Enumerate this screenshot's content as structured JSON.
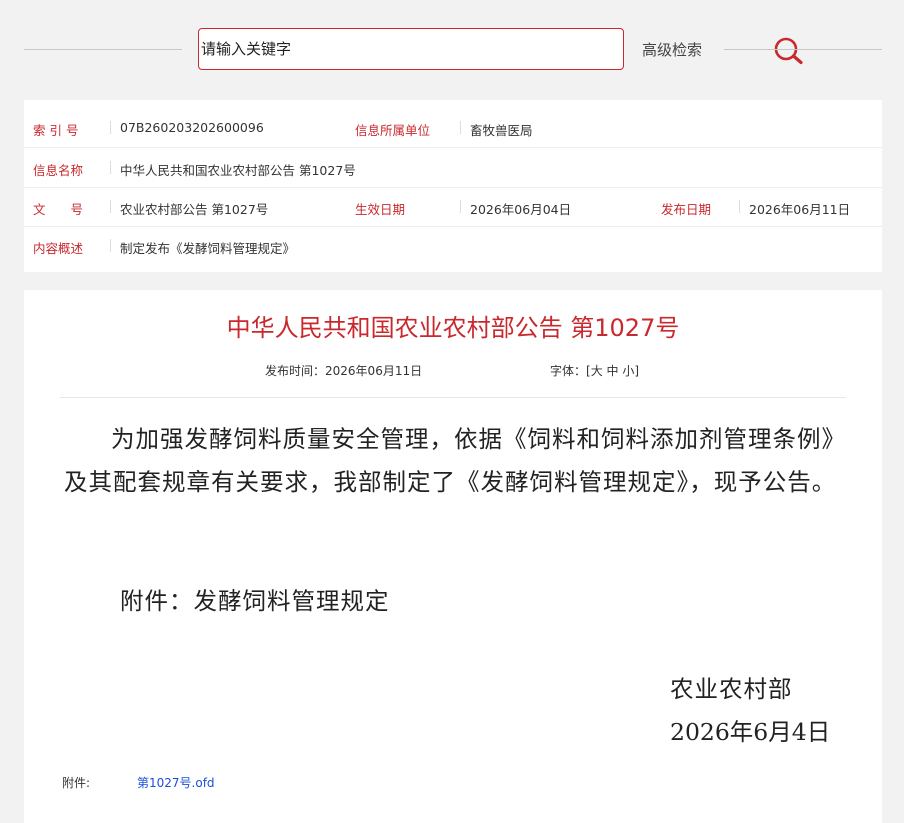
{
  "search": {
    "placeholder": "请输入关键字",
    "advanced_label": "高级检索"
  },
  "meta": {
    "index_label": "索 引 号",
    "index_value": "07B260203202600096",
    "unit_label": "信息所属单位",
    "unit_value": "畜牧兽医局",
    "name_label": "信息名称",
    "name_value": "中华人民共和国农业农村部公告 第1027号",
    "doc_no_label": "文　　号",
    "doc_no_value": "农业农村部公告 第1027号",
    "effective_label": "生效日期",
    "effective_value": "2026年06月04日",
    "publish_label": "发布日期",
    "publish_value": "2026年06月11日",
    "summary_label": "内容概述",
    "summary_value": "制定发布《发酵饲料管理规定》"
  },
  "article": {
    "title": "中华人民共和国农业农村部公告 第1027号",
    "publish_time_label": "发布时间：",
    "publish_time_value": "2026年06月11日",
    "font_label": "字体：",
    "font_open": "[",
    "font_large": "大",
    "font_medium": "中",
    "font_small": "小",
    "font_close": "]",
    "body": "为加强发酵饲料质量安全管理，依据《饲料和饲料添加剂管理条例》及其配套规章有关要求，我部制定了《发酵饲料管理规定》，现予公告。",
    "attachment_line": "附件：发酵饲料管理规定",
    "signature_org": "农业农村部",
    "signature_date": "2026年6月4日",
    "file_label": "附件:",
    "file_name": "第1027号.ofd"
  },
  "colors": {
    "accent": "#c9282d",
    "link": "#1a4fd6",
    "background": "#f2f2f2"
  }
}
